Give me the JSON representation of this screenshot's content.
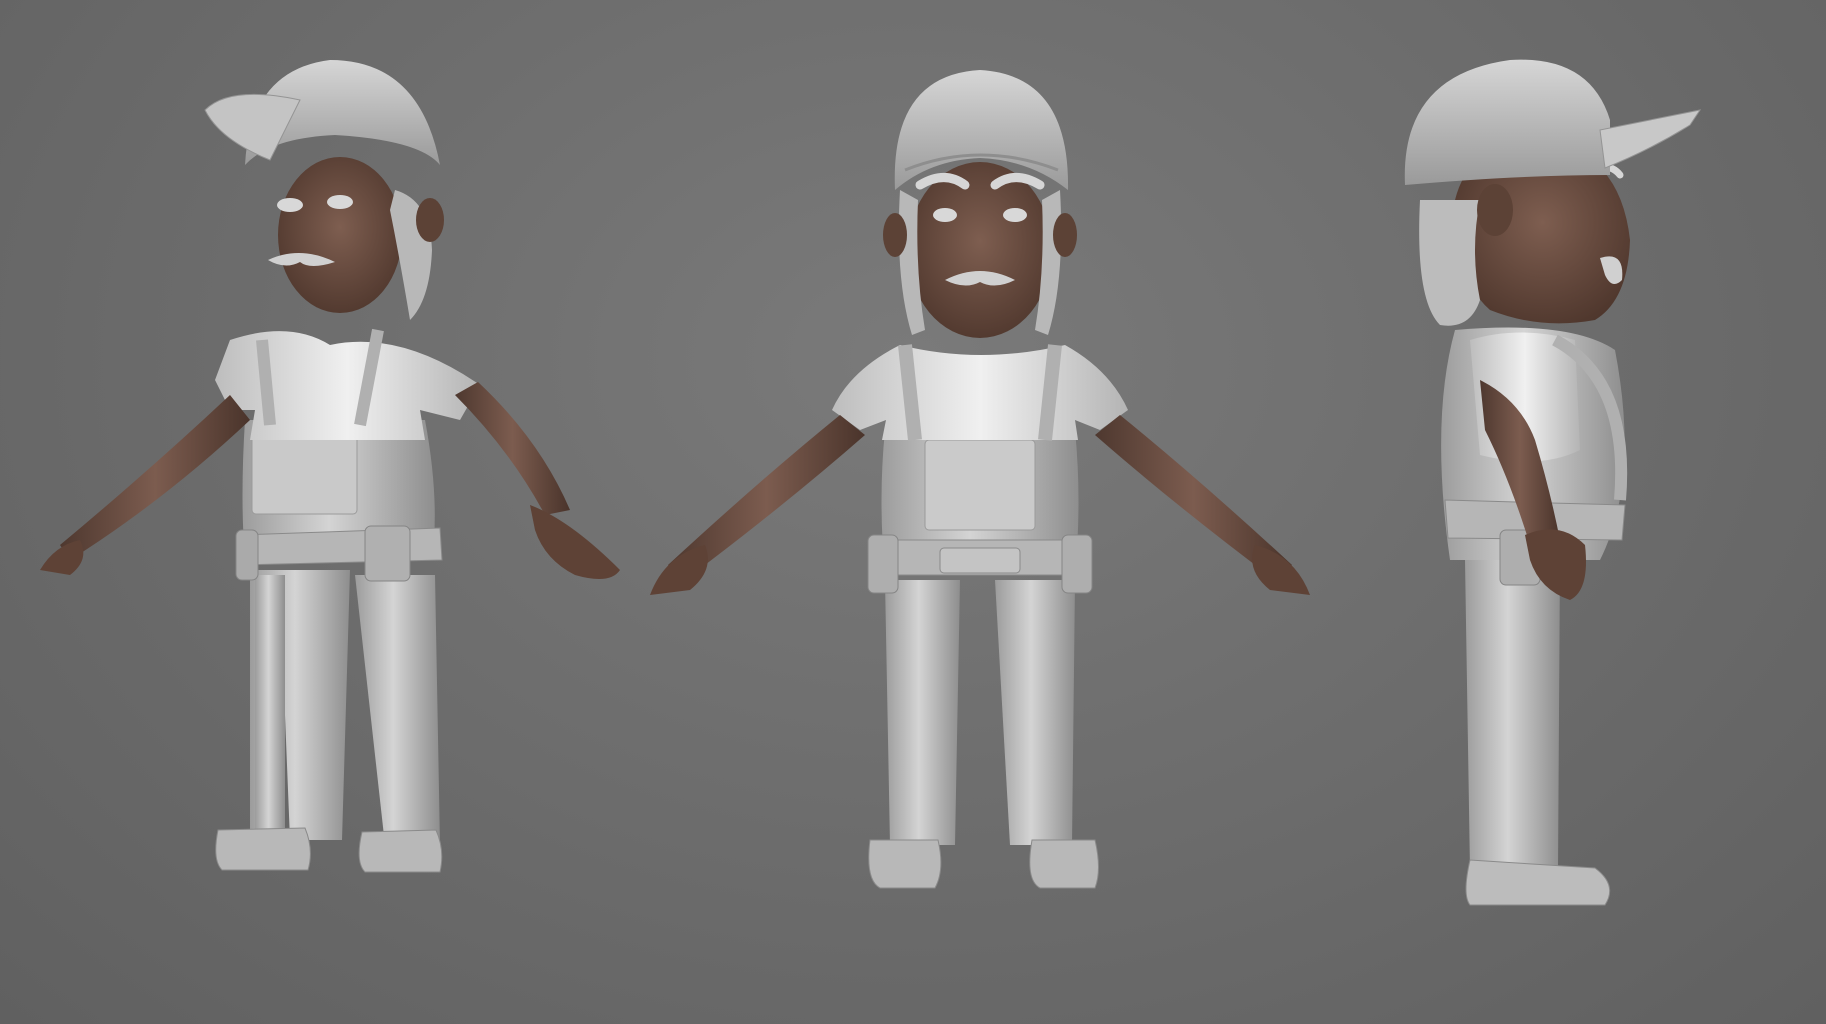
{
  "scene": {
    "background_color": "#6e6e6e",
    "clay_color": "#c8c8c8",
    "skin_color": "#6e5246",
    "views": [
      {
        "name": "three-quarter-view"
      },
      {
        "name": "front-view"
      },
      {
        "name": "side-view"
      }
    ]
  }
}
